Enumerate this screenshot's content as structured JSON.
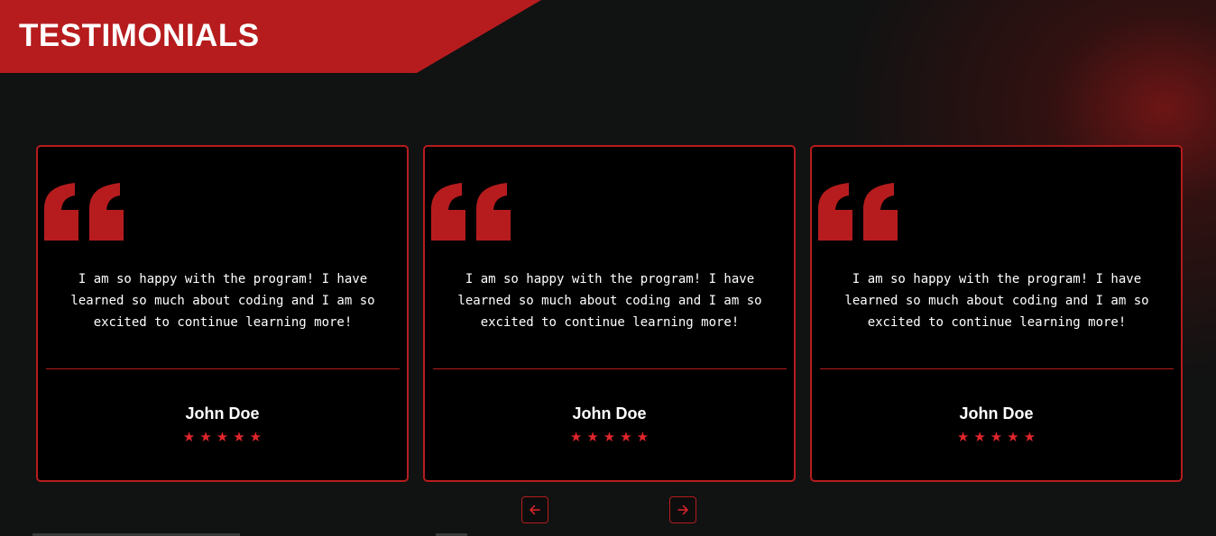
{
  "header": {
    "title": "TESTIMONIALS"
  },
  "colors": {
    "accent": "#b61c1e",
    "star": "#e0252b",
    "background": "#111212",
    "card_background": "#000000"
  },
  "testimonials": [
    {
      "text": "I am so happy with the program! I have learned so much about coding and I am so excited to continue learning more!",
      "name": "John Doe",
      "stars": "★★★★★",
      "rating": 5
    },
    {
      "text": "I am so happy with the program! I have learned so much about coding and I am so excited to continue learning more!",
      "name": "John Doe",
      "stars": "★★★★★",
      "rating": 5
    },
    {
      "text": "I am so happy with the program! I have learned so much about coding and I am so excited to continue learning more!",
      "name": "John Doe",
      "stars": "★★★★★",
      "rating": 5
    }
  ],
  "icons": {
    "quote": "quote-icon",
    "prev": "arrow-left-icon",
    "next": "arrow-right-icon"
  }
}
